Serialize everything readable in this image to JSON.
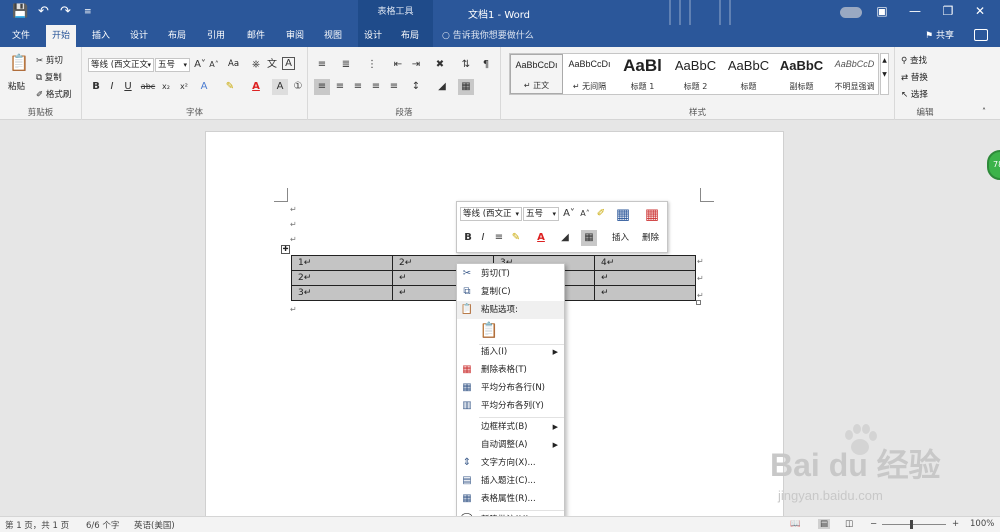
{
  "titlebar": {
    "context_tab_group": "表格工具",
    "title": "文档1 - Word",
    "icons": [
      "save-icon",
      "undo-icon",
      "redo-icon",
      "customize-icon",
      "ribbon-display-icon",
      "minimize-icon",
      "restore-icon",
      "close-icon"
    ]
  },
  "tabs": {
    "file": "文件",
    "home": "开始",
    "insert": "插入",
    "design": "设计",
    "layout": "布局",
    "references": "引用",
    "mailings": "邮件",
    "review": "审阅",
    "view": "视图",
    "table_design": "设计",
    "table_layout": "布局",
    "tell_me": "告诉我你想要做什么",
    "share": "共享"
  },
  "ribbon": {
    "clipboard": {
      "paste": "粘贴",
      "cut": "剪切",
      "copy": "复制",
      "format_painter": "格式刷",
      "label": "剪贴板"
    },
    "font": {
      "font_name": "等线 (西文正文",
      "font_size": "五号",
      "aa_label": "Aa",
      "label": "字体"
    },
    "paragraph": {
      "label": "段落"
    },
    "styles": {
      "label": "样式",
      "items": [
        {
          "preview": "AaBbCcDı",
          "name": "↵ 正文"
        },
        {
          "preview": "AaBbCcDı",
          "name": "↵ 无间隔"
        },
        {
          "preview": "AaBl",
          "name": "标题 1"
        },
        {
          "preview": "AaBbC",
          "name": "标题 2"
        },
        {
          "preview": "AaBbC",
          "name": "标题"
        },
        {
          "preview": "AaBbC",
          "name": "副标题"
        },
        {
          "preview": "AaBbCcD",
          "name": "不明显强调"
        }
      ]
    },
    "editing": {
      "find": "查找",
      "replace": "替换",
      "select": "选择",
      "label": "编辑"
    }
  },
  "mini_toolbar": {
    "font_name": "等线 (西文正",
    "font_size": "五号",
    "insert": "插入",
    "delete": "删除"
  },
  "table": {
    "rows": [
      [
        "1↵",
        "2↵",
        "3↵",
        "4↵"
      ],
      [
        "2↵",
        "↵",
        "↵",
        "↵"
      ],
      [
        "3↵",
        "↵",
        "↵",
        "↵"
      ]
    ],
    "end_mark": "↵"
  },
  "context_menu": {
    "items": [
      {
        "label": "剪切(T)",
        "icon": "scissors-icon"
      },
      {
        "label": "复制(C)",
        "icon": "copy-icon"
      },
      {
        "label": "粘贴选项:",
        "icon": "paste-icon"
      },
      {
        "label": "插入(I)",
        "icon": "",
        "submenu": true
      },
      {
        "label": "删除表格(T)",
        "icon": "delete-table-icon"
      },
      {
        "label": "平均分布各行(N)",
        "icon": "distribute-rows-icon"
      },
      {
        "label": "平均分布各列(Y)",
        "icon": "distribute-columns-icon"
      },
      {
        "label": "边框样式(B)",
        "icon": "",
        "submenu": true
      },
      {
        "label": "自动调整(A)",
        "icon": "",
        "submenu": true
      },
      {
        "label": "文字方向(X)...",
        "icon": "text-direction-icon"
      },
      {
        "label": "插入题注(C)...",
        "icon": "caption-icon"
      },
      {
        "label": "表格属性(R)...",
        "icon": "table-properties-icon"
      },
      {
        "label": "新建批注(M)",
        "icon": "comment-icon"
      }
    ]
  },
  "status": {
    "page": "第 1 页，共 1 页",
    "words": "6/6 个字",
    "language": "英语(美国)",
    "zoom": "100%",
    "zoom_fraction": 0.45
  },
  "badge": {
    "text": "78"
  },
  "watermark": {
    "brand": "Bai du 经验",
    "sub": "jingyan.baidu.com"
  },
  "colors": {
    "accent": "#2b579a",
    "context_tab": "#1f4b8a",
    "table_fill": "#c4c4c4"
  }
}
